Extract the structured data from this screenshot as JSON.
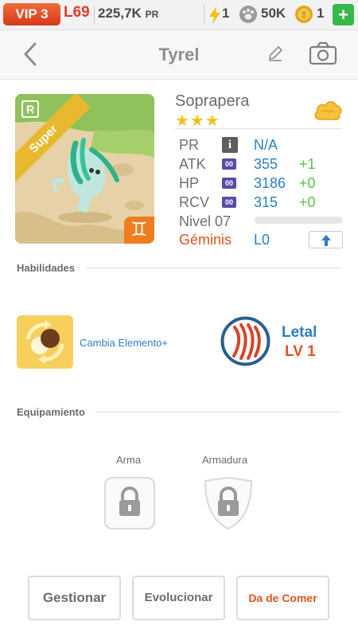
{
  "status_bar": {
    "vip": "VIP 3",
    "level": "L69",
    "power": "225,7K",
    "power_unit": "PR",
    "energy": "1",
    "paws": "50K",
    "coins": "1",
    "add_label": "+"
  },
  "header": {
    "title": "Tyrel",
    "back_icon": "chevron-left-icon",
    "edit_icon": "pencil-icon",
    "camera_icon": "camera-icon"
  },
  "monster": {
    "rarity_badge": "R",
    "grade_ribbon": "Super",
    "zodiac_symbol": "♊",
    "species": "Soprapera",
    "stars": "★★★",
    "element_icon": "cloud-icon",
    "stats": {
      "pr_label": "PR",
      "pr_value": "N/A",
      "atk_label": "ATK",
      "atk_value": "355",
      "atk_bonus": "+1",
      "hp_label": "HP",
      "hp_value": "3186",
      "hp_bonus": "+0",
      "rcv_label": "RCV",
      "rcv_value": "315",
      "rcv_bonus": "+0",
      "box_label": "00",
      "info_label": "i"
    },
    "level_label": "Nivel 07",
    "xp_fraction": 0.0,
    "sign_label": "Géminis",
    "sign_level": "L0",
    "upgrade_icon": "arrow-up-icon"
  },
  "abilities": {
    "section_title": "Habilidades",
    "skill_name": "Cambia Elemento+",
    "passive_name": "Letal",
    "passive_level": "LV 1"
  },
  "equipment": {
    "section_title": "Equipamiento",
    "weapon_label": "Arma",
    "armor_label": "Armadura"
  },
  "actions": {
    "manage": "Gestionar",
    "evolve": "Evolucionar",
    "feed": "Da de Comer"
  },
  "colors": {
    "accent_blue": "#2a7ec8",
    "accent_orange": "#e0531e",
    "bonus_green": "#5cc24a",
    "star_gold": "#f2c018"
  }
}
